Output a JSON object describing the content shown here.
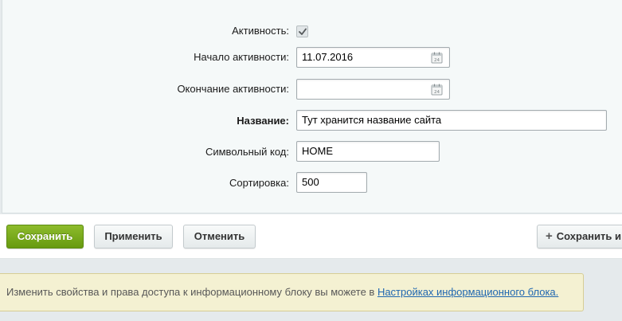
{
  "form": {
    "active": {
      "label": "Активность:",
      "checked": true
    },
    "date_from": {
      "label": "Начало активности:",
      "value": "11.07.2016"
    },
    "date_to": {
      "label": "Окончание активности:",
      "value": ""
    },
    "name": {
      "label": "Название:",
      "value": "Тут хранится название сайта"
    },
    "code": {
      "label": "Символьный код:",
      "value": "HOME"
    },
    "sort": {
      "label": "Сортировка:",
      "value": "500"
    }
  },
  "buttons": {
    "save": "Сохранить",
    "apply": "Применить",
    "cancel": "Отменить",
    "save_and_add": "Сохранить и"
  },
  "notice": {
    "text": "Изменить свойства и права доступа к информационному блоку вы можете в ",
    "link": "Настройках информационного блока."
  },
  "icons": {
    "checkbox": "checkmark-icon",
    "calendar": "calendar-icon",
    "plus": "plus-icon"
  },
  "colors": {
    "save_button": "#7aad1e",
    "link": "#2067b0",
    "notice_background": "#f4f1d2"
  }
}
